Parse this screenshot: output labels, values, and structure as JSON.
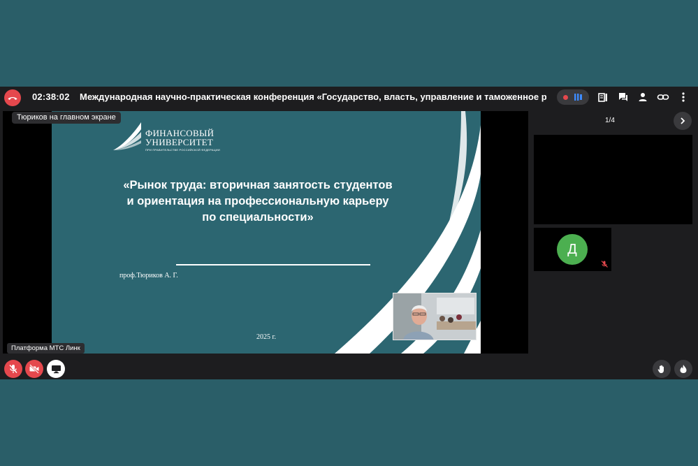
{
  "header": {
    "timer": "02:38:02",
    "title": "Международная научно-практическая конференция «Государство, власть, управление и таможенное регулирование»"
  },
  "stage": {
    "label": "Тюриков на главном экране",
    "platform_label": "Платформа МТС Линк"
  },
  "slide": {
    "logo_line1": "ФИНАНСОВЫЙ",
    "logo_line2": "УНИВЕРСИТЕТ",
    "logo_sub": "ПРИ ПРАВИТЕЛЬСТВЕ РОССИЙСКОЙ ФЕДЕРАЦИИ",
    "title": "«Рынок труда: вторичная занятость студентов и ориентация на профессиональную карьеру по специальности»",
    "author": "проф.Тюриков А. Г.",
    "year": "2025 г."
  },
  "participants": {
    "page": "1/4",
    "avatar_initial": "Д"
  },
  "colors": {
    "background": "#2a5e68",
    "app": "#1d1d1f",
    "slide": "#2c6671",
    "danger": "#e5484d",
    "avatar": "#4caf50"
  },
  "icons": [
    "phone-hangup-icon",
    "record-icon",
    "pause-icon",
    "notes-icon",
    "chat-icon",
    "person-icon",
    "link-icon",
    "more-vertical-icon",
    "chevron-right-icon",
    "mic-off-icon",
    "camera-off-icon",
    "screen-share-icon",
    "raise-hand-icon",
    "fire-icon"
  ]
}
